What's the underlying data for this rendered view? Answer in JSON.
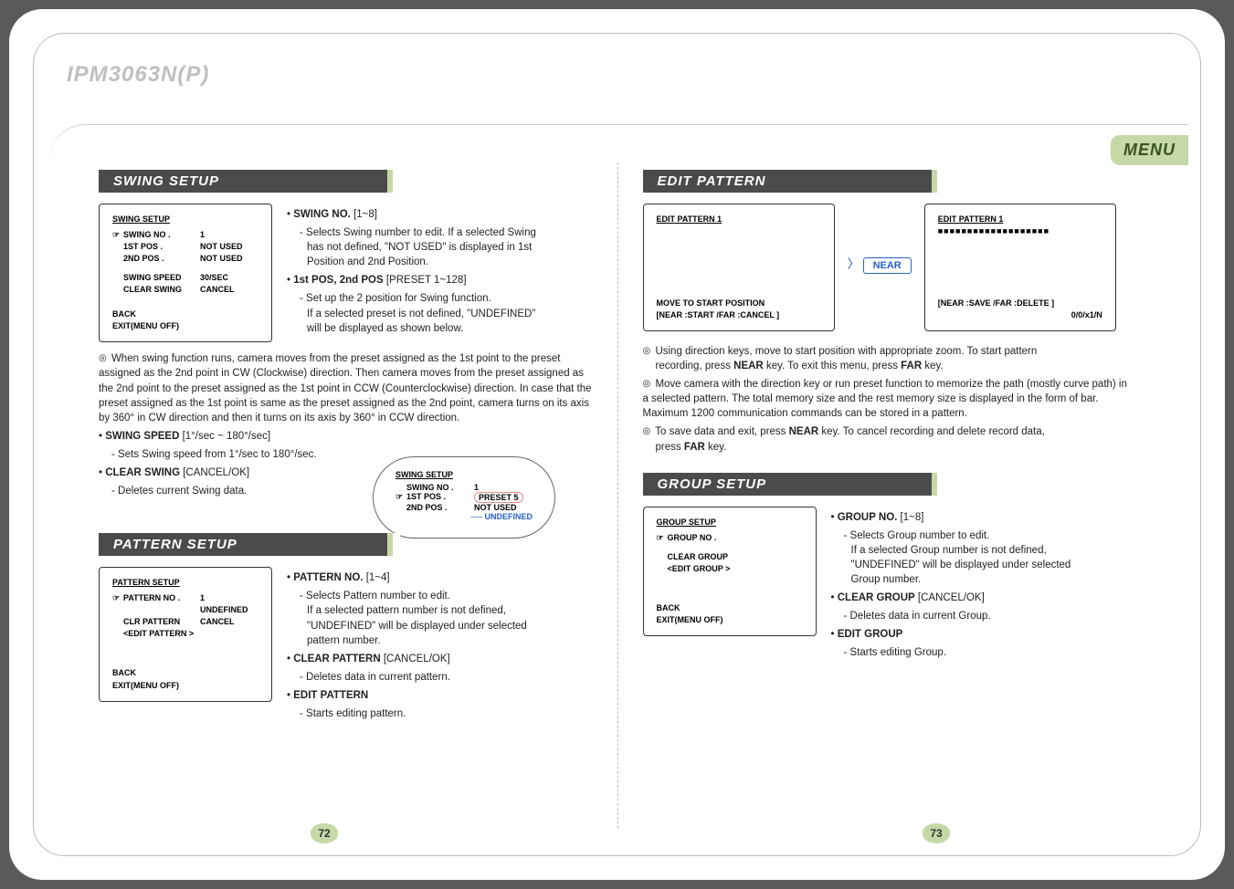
{
  "header": {
    "model": "IPM3063N(P)",
    "menu_tab": "MENU"
  },
  "pages": {
    "left": "72",
    "right": "73"
  },
  "swing": {
    "heading": "SWING SETUP",
    "osd": {
      "title": "SWING SETUP",
      "rows": [
        {
          "k": "SWING NO  .",
          "v": "1",
          "ptr": true
        },
        {
          "k": "1ST POS  .",
          "v": "NOT USED"
        },
        {
          "k": "2ND POS  .",
          "v": "NOT USED"
        },
        {
          "k": "SWING SPEED",
          "v": "30/SEC"
        },
        {
          "k": "CLEAR SWING",
          "v": "CANCEL"
        }
      ],
      "back": "BACK",
      "exit": "EXIT(MENU OFF)"
    },
    "bullets": {
      "no_title": "SWING NO.",
      "no_range": "[1~8]",
      "no_desc1": "- Selects Swing number to edit. If a selected Swing",
      "no_desc2": "has not defined, \"NOT USED\" is displayed in 1st",
      "no_desc3": "Position and 2nd Position.",
      "pos_title": "1st  POS, 2nd POS",
      "pos_range": "[PRESET 1~128]",
      "pos_desc1": "- Set up the 2 position for Swing function.",
      "pos_desc2": "If a selected preset is not defined, \"UNDEFINED\"",
      "pos_desc3": "will be displayed as shown below."
    },
    "para": "When swing function runs, camera moves from the preset assigned as the 1st point to the preset assigned  as the 2nd point in CW (Clockwise) direction. Then camera moves from the preset assigned as the 2nd point to the preset assigned as the 1st point in CCW (Counterclockwise) direction. In case that the preset assigned as the 1st point is same as the preset assigned as the 2nd point, camera turns on its axis by 360° in CW direction and then it turns on its axis by 360° in CCW direction.",
    "speed_title": "SWING SPEED",
    "speed_range": "[1°/sec ~ 180°/sec]",
    "speed_desc": "- Sets Swing speed from 1°/sec to 180°/sec.",
    "clear_title": "CLEAR SWING",
    "clear_range": "[CANCEL/OK]",
    "clear_desc": "- Deletes current Swing data.",
    "mini": {
      "title": "SWING SETUP",
      "r1k": "SWING NO  .",
      "r1v": "1",
      "r2k": "1ST POS  .",
      "r2v": "PRESET  5",
      "r3k": "2ND POS  .",
      "r3v": "NOT USED",
      "undef": "UNDEFINED"
    }
  },
  "pattern": {
    "heading": "PATTERN SETUP",
    "osd": {
      "title": "PATTERN SETUP",
      "rows": [
        {
          "k": "PATTERN NO  .",
          "v": "1",
          "ptr": true
        },
        {
          "k": "",
          "v": "UNDEFINED"
        },
        {
          "k": "CLR PATTERN",
          "v": "CANCEL"
        },
        {
          "k": "<EDIT PATTERN  >",
          "v": ""
        }
      ],
      "back": "BACK",
      "exit": "EXIT(MENU OFF)"
    },
    "bullets": {
      "no_title": "PATTERN NO.",
      "no_range": "[1~4]",
      "no_desc1": "- Selects Pattern number to edit.",
      "no_desc2": "If a selected   pattern number is not defined,",
      "no_desc3": "\"UNDEFINED\" will be displayed under selected",
      "no_desc4": "pattern number.",
      "clr_title": "CLEAR PATTERN",
      "clr_range": "[CANCEL/OK]",
      "clr_desc": "- Deletes data in current pattern.",
      "edit_title": "EDIT PATTERN",
      "edit_desc": "- Starts editing pattern."
    }
  },
  "editpattern": {
    "heading": "EDIT PATTERN",
    "left_osd": {
      "title": "EDIT PATTERN    1",
      "move": "MOVE TO START POSITION",
      "keys": "[NEAR :START   /FAR :CANCEL  ]"
    },
    "near": "NEAR",
    "right_osd": {
      "title": "EDIT PATTERN    1",
      "bar": "■■■■■■■■■■■■■■■■■■■",
      "keys": "[NEAR :SAVE       /FAR :DELETE  ]",
      "status": "0/0/x1/N"
    },
    "para1a": "Using direction keys, move to start position with appropriate zoom. To start pattern",
    "para1b": "recording, press ",
    "para1c": " key. To exit this menu, press ",
    "para1d": " key.",
    "k_near": "NEAR",
    "k_far": "FAR",
    "para2": "Move camera with the direction key or run preset function to memorize the path (mostly curve path) in a selected pattern. The total memory size and the rest memory size is displayed in the form of bar. Maximum 1200 communication commands can be stored in a pattern.",
    "para3a": "To save data and exit, press ",
    "para3b": " key. To cancel recording and delete record data,",
    "para3c": "press ",
    "para3d": " key."
  },
  "group": {
    "heading": "GROUP SETUP",
    "osd": {
      "title": "GROUP SETUP",
      "rows": [
        {
          "k": "GROUP NO  .",
          "v": "",
          "ptr": true
        },
        {
          "k": "CLEAR GROUP",
          "v": ""
        },
        {
          "k": "<EDIT GROUP   >",
          "v": ""
        }
      ],
      "back": "BACK",
      "exit": "EXIT(MENU OFF)"
    },
    "bullets": {
      "no_title": "GROUP NO.",
      "no_range": "[1~8]",
      "no_desc1": "- Selects Group number to edit.",
      "no_desc2": "If a selected   Group number is not defined,",
      "no_desc3": "\"UNDEFINED\" will be displayed under selected",
      "no_desc4": "Group number.",
      "clr_title": "CLEAR GROUP",
      "clr_range": "[CANCEL/OK]",
      "clr_desc": "- Deletes data in current Group.",
      "edit_title": "EDIT GROUP",
      "edit_desc": "- Starts editing Group."
    }
  }
}
